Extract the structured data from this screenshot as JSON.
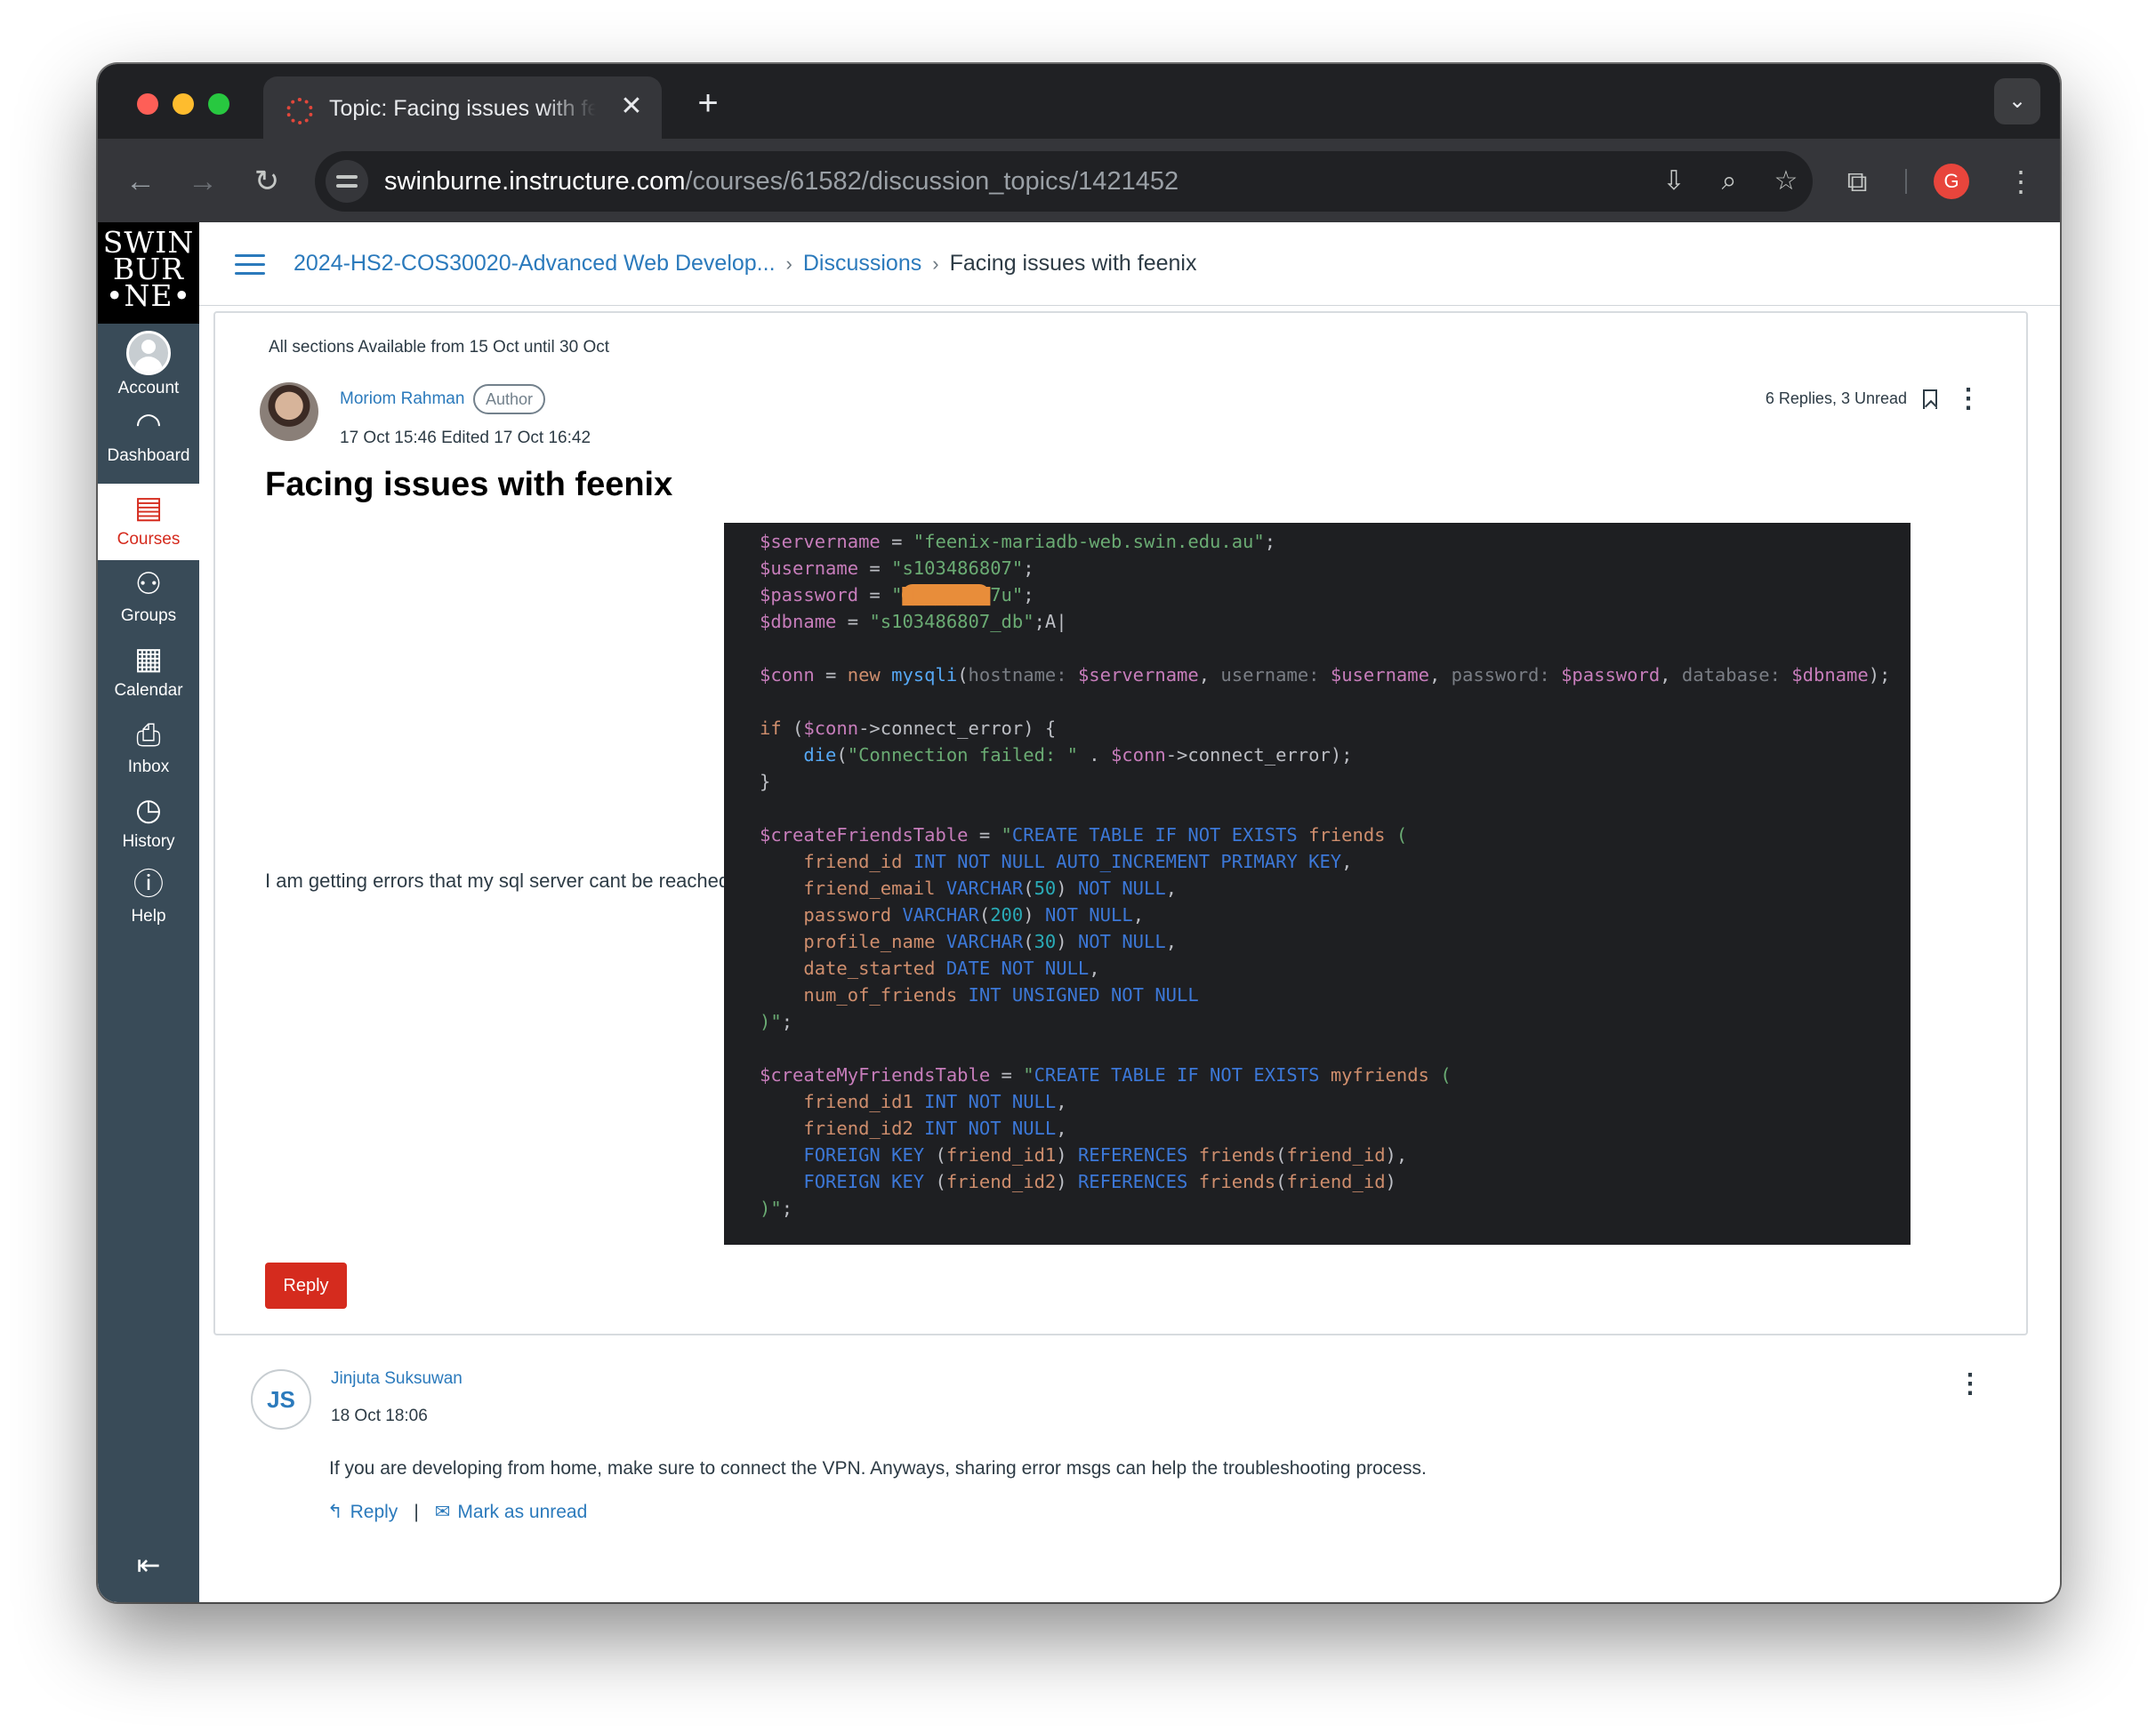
{
  "browser": {
    "tab_title": "Topic: Facing issues with feenix",
    "tab_close": "✕",
    "new_tab": "+",
    "tab_menu": "⌄",
    "url_host": "swinburne.instructure.com",
    "url_path": "/courses/61582/discussion_topics/1421452",
    "profile_initial": "G"
  },
  "global_nav": {
    "logo_lines": [
      "SWIN",
      "BUR",
      "•NE•"
    ],
    "items": [
      {
        "label": "Account",
        "icon": "account-icon"
      },
      {
        "label": "Dashboard",
        "icon": "dashboard-icon"
      },
      {
        "label": "Courses",
        "icon": "courses-icon",
        "active": true
      },
      {
        "label": "Groups",
        "icon": "groups-icon"
      },
      {
        "label": "Calendar",
        "icon": "calendar-icon"
      },
      {
        "label": "Inbox",
        "icon": "inbox-icon"
      },
      {
        "label": "History",
        "icon": "history-icon"
      },
      {
        "label": "Help",
        "icon": "help-icon"
      }
    ]
  },
  "breadcrumb": {
    "course": "2024-HS2-COS30020-Advanced Web Develop...",
    "section": "Discussions",
    "current": "Facing issues with feenix"
  },
  "topic": {
    "availability": "All sections Available from 15 Oct until 30 Oct",
    "author": "Moriom Rahman",
    "author_badge": "Author",
    "date": "17 Oct 15:46  Edited 17 Oct 16:42",
    "replies": "6 Replies, 3 Unread",
    "title": "Facing issues with feenix",
    "body": "I am getting errors that my sql server cant be reached.",
    "reply_button": "Reply"
  },
  "reply": {
    "initials": "JS",
    "author": "Jinjuta Suksuwan",
    "date": "18 Oct 18:06",
    "body": "If you are developing from home, make sure to connect the VPN. Anyways, sharing error msgs can help the troubleshooting process.",
    "reply_label": "Reply",
    "separator": "|",
    "mark_unread_label": "Mark as unread"
  },
  "colors": {
    "canvas_red": "#d52b1e",
    "link_blue": "#2b7abc",
    "nav_bg": "#394b58",
    "code_bg": "#1e1f22"
  }
}
